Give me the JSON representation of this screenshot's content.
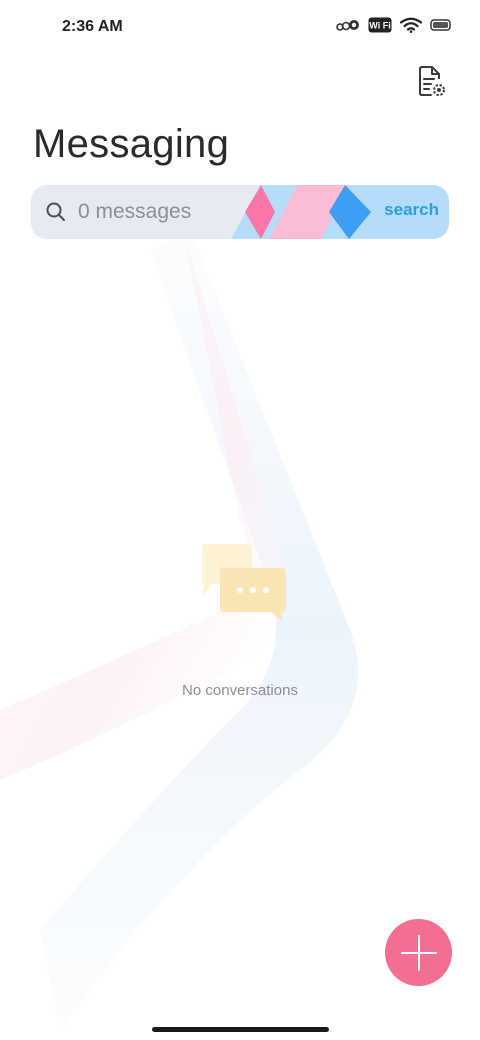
{
  "status_bar": {
    "time": "2:36 AM",
    "icons": [
      "network-indicator-icon",
      "wifi-badge-icon",
      "wifi-signal-icon",
      "battery-icon"
    ],
    "wifi_badge": "Wi Fi"
  },
  "header": {
    "title": "Messaging",
    "settings_icon": "document-settings-icon"
  },
  "search": {
    "placeholder": "0 messages",
    "button_label": "search",
    "icon": "search-icon"
  },
  "empty_state": {
    "icon": "chat-bubbles-icon",
    "text": "No conversations"
  },
  "fab": {
    "icon": "plus-icon",
    "color": "#f26e92"
  },
  "colors": {
    "accent_pink": "#f26e92",
    "search_blue": "#2b9de3",
    "search_bg": "#e6eaf2"
  }
}
